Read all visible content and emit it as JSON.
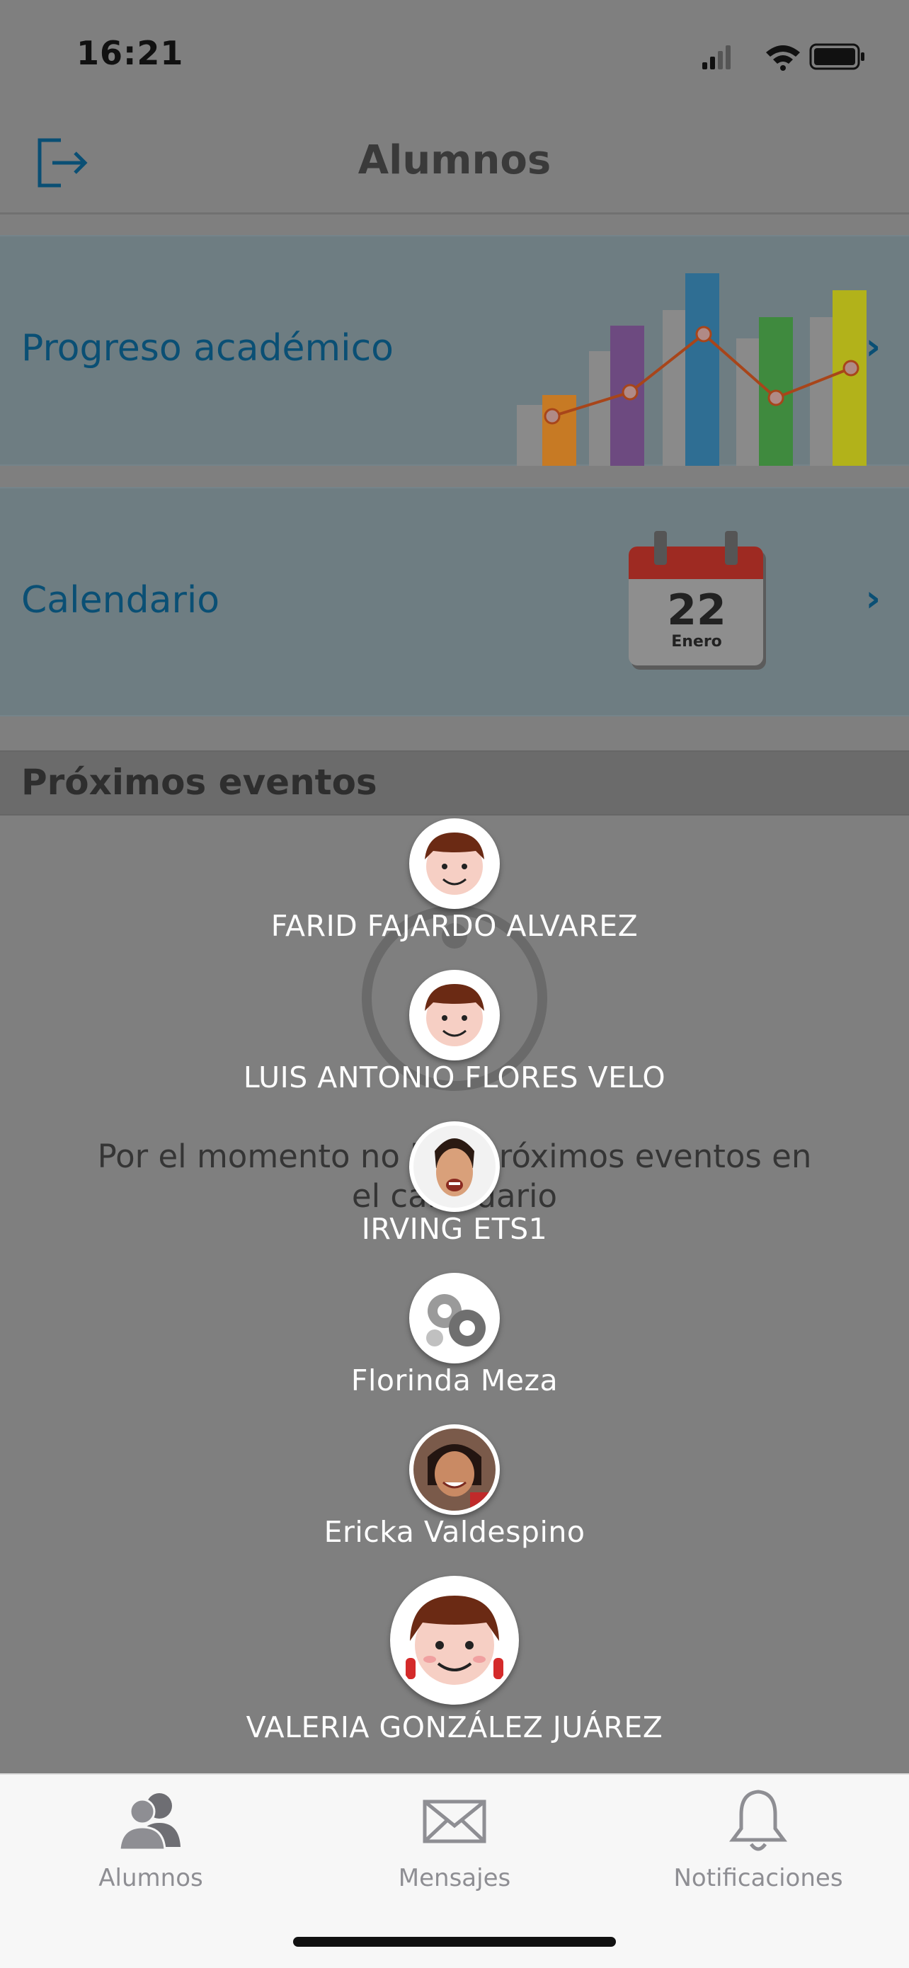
{
  "status_bar": {
    "time": "16:21"
  },
  "nav": {
    "title": "Alumnos"
  },
  "cards": [
    {
      "label": "Progreso académico"
    },
    {
      "label": "Calendario",
      "calendar_day": "22",
      "calendar_month": "Enero"
    }
  ],
  "section": {
    "title": "Próximos eventos",
    "empty_line1": "Por el momento no hay próximos eventos en",
    "empty_line2": "el calendario"
  },
  "students": [
    {
      "name": "FARID FAJARDO ALVAREZ",
      "avatar": "cartoon-boy-avatar"
    },
    {
      "name": "LUIS ANTONIO FLORES VELO",
      "avatar": "cartoon-boy-avatar"
    },
    {
      "name": "IRVING ETS1",
      "avatar": "photo-avatar"
    },
    {
      "name": "Florinda Meza",
      "avatar": "gear-graphic-avatar"
    },
    {
      "name": "Ericka Valdespino",
      "avatar": "photo-avatar"
    },
    {
      "name": "VALERIA GONZÁLEZ JUÁREZ",
      "avatar": "cartoon-girl-avatar"
    }
  ],
  "tabs": [
    {
      "label": "Alumnos",
      "icon": "people-icon",
      "active": true
    },
    {
      "label": "Mensajes",
      "icon": "envelope-icon",
      "active": false
    },
    {
      "label": "Notificaciones",
      "icon": "bell-icon",
      "active": false
    }
  ],
  "colors": {
    "accent": "#0a4f74",
    "overlay": "#7f7f7f",
    "chart_bars": [
      "#c77a24",
      "#6d4a80",
      "#2f6e93",
      "#3f8a3e",
      "#b2b21a"
    ],
    "calendar_red": "#9e2a22"
  }
}
